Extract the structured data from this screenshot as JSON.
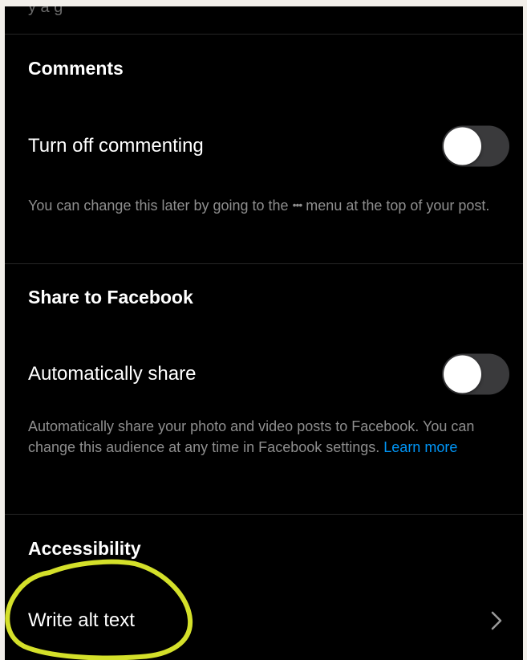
{
  "top_partial_text": "y      a      g",
  "comments": {
    "section_title": "Comments",
    "toggle_label": "Turn off commenting",
    "toggle_on": false,
    "description_before": "You can change this later by going to the ",
    "menu_glyph": "•••",
    "description_after": " menu at the top of your post."
  },
  "facebook": {
    "section_title": "Share to Facebook",
    "toggle_label": "Automatically share",
    "toggle_on": false,
    "description": "Automatically share your photo and video posts to Facebook. You can change this audience at any time in Facebook settings. ",
    "learn_more": "Learn more"
  },
  "accessibility": {
    "section_title": "Accessibility",
    "row_label": "Write alt text",
    "chevron_icon": "chevron-right-icon"
  },
  "colors": {
    "background": "#000000",
    "text_primary": "#ffffff",
    "text_secondary": "#8e8e8e",
    "link": "#0095f6",
    "toggle_off_track": "#3a3a3c",
    "highlight_marker": "#d4e02a"
  }
}
